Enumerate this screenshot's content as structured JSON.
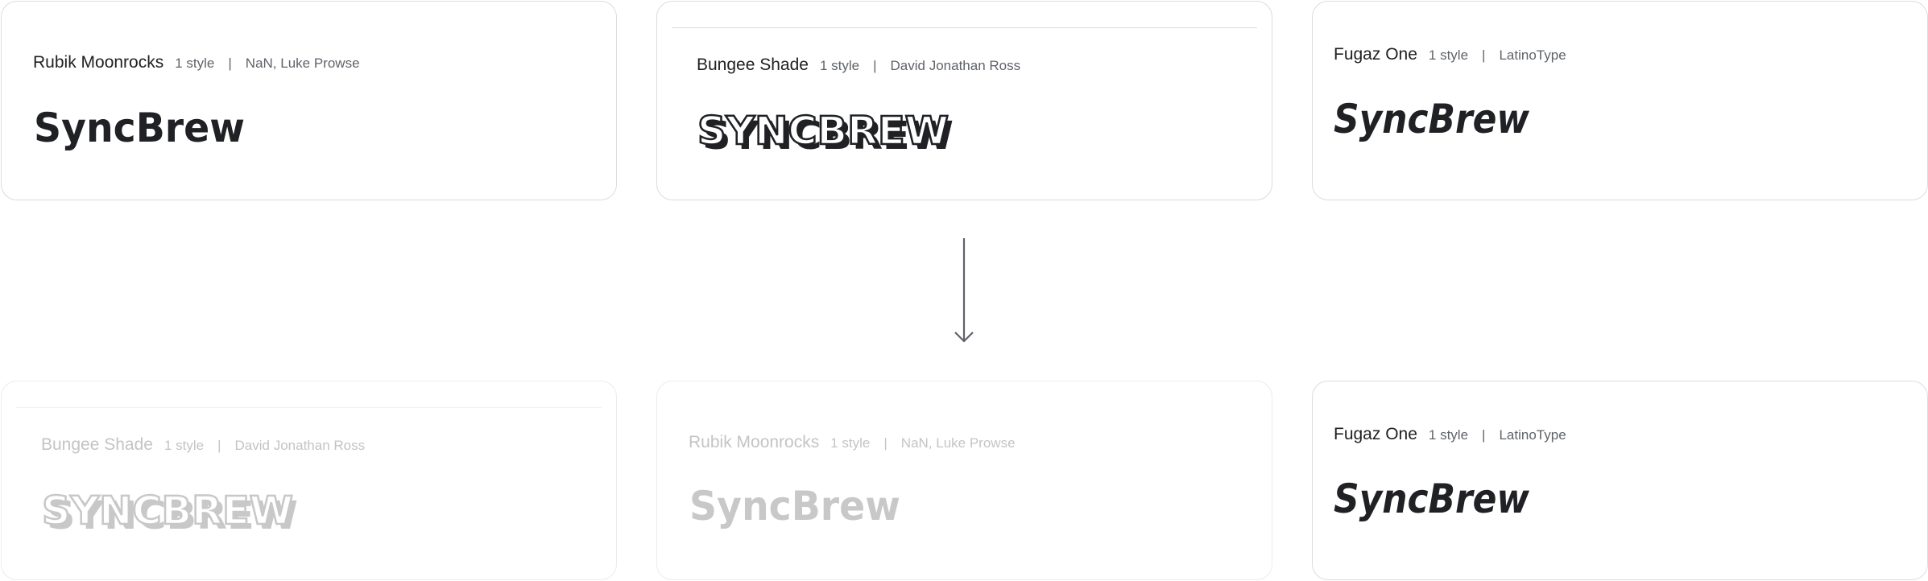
{
  "top_row": [
    {
      "family": "Rubik Moonrocks",
      "styles": "1 style",
      "separator": "|",
      "designer": "NaN, Luke Prowse",
      "preview": "SyncBrew"
    },
    {
      "family": "Bungee Shade",
      "styles": "1 style",
      "separator": "|",
      "designer": "David Jonathan Ross",
      "preview": "SYNCBREW"
    },
    {
      "family": "Fugaz One",
      "styles": "1 style",
      "separator": "|",
      "designer": "LatinoType",
      "preview": "SyncBrew"
    }
  ],
  "bottom_row": [
    {
      "family": "Bungee Shade",
      "styles": "1 style",
      "separator": "|",
      "designer": "David Jonathan Ross",
      "preview": "SYNCBREW"
    },
    {
      "family": "Rubik Moonrocks",
      "styles": "1 style",
      "separator": "|",
      "designer": "NaN, Luke Prowse",
      "preview": "SyncBrew"
    },
    {
      "family": "Fugaz One",
      "styles": "1 style",
      "separator": "|",
      "designer": "LatinoType",
      "preview": "SyncBrew"
    }
  ],
  "arrow_icon": "arrow-down-icon",
  "colors": {
    "text_primary": "#202124",
    "text_secondary": "#5f6368",
    "border": "#dadce0",
    "faded_text": "#c4c4c4",
    "faded_preview": "#c8c8c8"
  }
}
